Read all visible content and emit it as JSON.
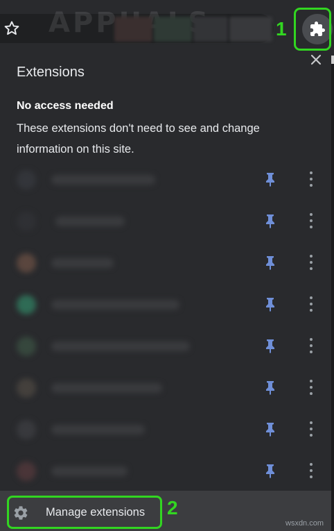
{
  "toolbar": {
    "bookmark_icon": "star-icon",
    "extensions_icon": "puzzle-icon",
    "watermark": "APPUALS"
  },
  "annotations": {
    "marker1": "1",
    "marker2": "2",
    "highlight_color": "#32d621"
  },
  "panel": {
    "title": "Extensions",
    "close_icon": "close-icon",
    "section_heading": "No access needed",
    "description": "These extensions don't need to see and change information on this site.",
    "extensions": [
      {
        "pin_icon": "pin-icon",
        "menu_icon": "more-vert-icon"
      },
      {
        "pin_icon": "pin-icon",
        "menu_icon": "more-vert-icon"
      },
      {
        "pin_icon": "pin-icon",
        "menu_icon": "more-vert-icon"
      },
      {
        "pin_icon": "pin-icon",
        "menu_icon": "more-vert-icon"
      },
      {
        "pin_icon": "pin-icon",
        "menu_icon": "more-vert-icon"
      },
      {
        "pin_icon": "pin-icon",
        "menu_icon": "more-vert-icon"
      },
      {
        "pin_icon": "pin-icon",
        "menu_icon": "more-vert-icon"
      },
      {
        "pin_icon": "pin-icon",
        "menu_icon": "more-vert-icon"
      }
    ],
    "footer_label": "Manage extensions",
    "footer_icon": "gear-icon"
  },
  "colors": {
    "panel_bg": "#292a2d",
    "footer_bg": "#3c3d40",
    "pin": "#6f8fd8"
  },
  "credit": "wsxdn.com"
}
